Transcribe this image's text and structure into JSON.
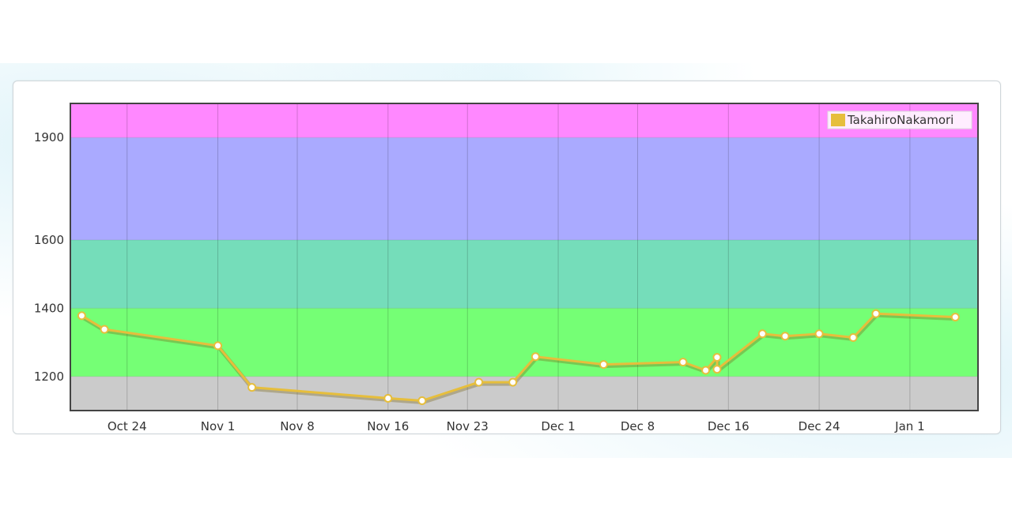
{
  "chart_data": {
    "type": "line",
    "y_axis": {
      "ylim": [
        1100,
        2000
      ],
      "ticks": [
        1200,
        1400,
        1600,
        1900
      ],
      "tick_labels": [
        "1200",
        "1400",
        "1600",
        "1900"
      ]
    },
    "x_axis": {
      "range": [
        "2019-10-19",
        "2020-01-07"
      ],
      "ticks": [
        "2019-10-24",
        "2019-11-01",
        "2019-11-08",
        "2019-11-16",
        "2019-11-23",
        "2019-12-01",
        "2019-12-08",
        "2019-12-16",
        "2019-12-24",
        "2020-01-01"
      ],
      "tick_labels": [
        "Oct 24",
        "Nov 1",
        "Nov 8",
        "Nov 16",
        "Nov 23",
        "Dec 1",
        "Dec 8",
        "Dec 16",
        "Dec 24",
        "Jan 1"
      ]
    },
    "bands": [
      {
        "from": 1100,
        "to": 1200,
        "color": "#cbcbcb"
      },
      {
        "from": 1200,
        "to": 1400,
        "color": "#75ff75"
      },
      {
        "from": 1400,
        "to": 1600,
        "color": "#75ddba"
      },
      {
        "from": 1600,
        "to": 1900,
        "color": "#aaaaff"
      },
      {
        "from": 1900,
        "to": 2000,
        "color": "#ff88ff"
      }
    ],
    "grid": true,
    "legend": {
      "position": "top-right"
    },
    "series": [
      {
        "name": "TakahiroNakamori",
        "color": "#e6be3c",
        "points": [
          {
            "x": "2019-10-20",
            "y": 1378
          },
          {
            "x": "2019-10-22",
            "y": 1338
          },
          {
            "x": "2019-11-01",
            "y": 1290
          },
          {
            "x": "2019-11-04",
            "y": 1168
          },
          {
            "x": "2019-11-16",
            "y": 1136
          },
          {
            "x": "2019-11-19",
            "y": 1129
          },
          {
            "x": "2019-11-24",
            "y": 1183
          },
          {
            "x": "2019-11-27",
            "y": 1183
          },
          {
            "x": "2019-11-29",
            "y": 1258
          },
          {
            "x": "2019-12-05",
            "y": 1235
          },
          {
            "x": "2019-12-12",
            "y": 1242
          },
          {
            "x": "2019-12-14",
            "y": 1218
          },
          {
            "x": "2019-12-15",
            "y": 1256
          },
          {
            "x": "2019-12-15",
            "y": 1221
          },
          {
            "x": "2019-12-19",
            "y": 1325
          },
          {
            "x": "2019-12-21",
            "y": 1318
          },
          {
            "x": "2019-12-24",
            "y": 1325
          },
          {
            "x": "2019-12-27",
            "y": 1314
          },
          {
            "x": "2019-12-29",
            "y": 1384
          },
          {
            "x": "2020-01-05",
            "y": 1374
          }
        ]
      }
    ]
  }
}
